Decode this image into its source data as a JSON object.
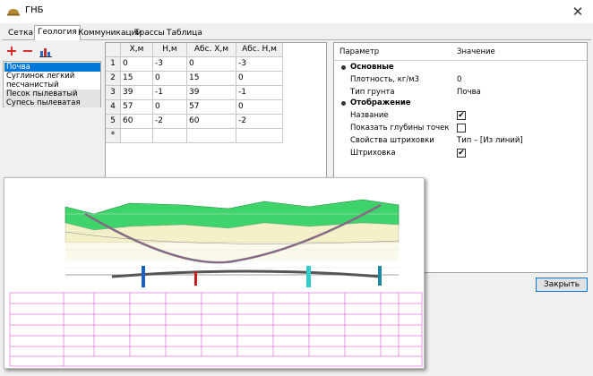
{
  "window": {
    "title": "ГНБ",
    "close_glyph": "✕"
  },
  "tabs": [
    {
      "label": "Сетка"
    },
    {
      "label": "Геология"
    },
    {
      "label": "Коммуникации"
    },
    {
      "label": "Трассы"
    },
    {
      "label": "Таблица"
    }
  ],
  "toolbar": {
    "add_glyph": "+",
    "remove_glyph": "−",
    "chart_icon": "layer-chart-icon"
  },
  "layers": [
    {
      "label": "Почва"
    },
    {
      "label": "Суглинок легкий"
    },
    {
      "label": "песчанистый"
    },
    {
      "label": "Песок пылеватый"
    },
    {
      "label": "Супесь пылеватая"
    }
  ],
  "grid": {
    "headers": [
      "X,м",
      "H,м",
      "Абс. X,м",
      "Абс. H,м"
    ],
    "rows": [
      {
        "n": "1",
        "x": "0",
        "h": "-3",
        "ax": "0",
        "ah": "-3"
      },
      {
        "n": "2",
        "x": "15",
        "h": "0",
        "ax": "15",
        "ah": "0"
      },
      {
        "n": "3",
        "x": "39",
        "h": "-1",
        "ax": "39",
        "ah": "-1"
      },
      {
        "n": "4",
        "x": "57",
        "h": "0",
        "ax": "57",
        "ah": "0"
      },
      {
        "n": "5",
        "x": "60",
        "h": "-2",
        "ax": "60",
        "ah": "-2"
      }
    ],
    "new_row_marker": "*"
  },
  "properties": {
    "col_param": "Параметр",
    "col_value": "Значение",
    "groups": [
      {
        "title": "Основные",
        "items": [
          {
            "label": "Плотность, кг/м3",
            "value": "0"
          },
          {
            "label": "Тип грунта",
            "value": "Почва"
          }
        ]
      },
      {
        "title": "Отображение",
        "items": [
          {
            "label": "Название",
            "checked": true
          },
          {
            "label": "Показать глубины точек",
            "checked": false
          },
          {
            "label": "Свойства штриховки",
            "value": "Тип – [Из линий]"
          },
          {
            "label": "Штриховка",
            "checked": true
          }
        ]
      }
    ],
    "check_glyph": "✔"
  },
  "buttons": {
    "close_label": "Закрыть"
  },
  "colors": {
    "accent": "#0078d7",
    "soil_green": "#3ed46b",
    "profile_magenta": "#cc33cc",
    "loam_yellow": "#f4f0c8"
  }
}
